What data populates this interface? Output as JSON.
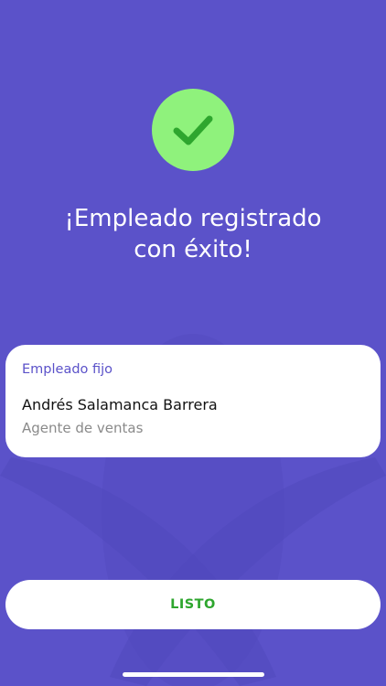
{
  "colors": {
    "background": "#5b52c9",
    "success_badge": "#8ff27c",
    "check_mark": "#2ea62e",
    "card_type_text": "#5b52c9",
    "button_text": "#2ea62e"
  },
  "success": {
    "icon": "check-icon",
    "title_line1": "¡Empleado registrado",
    "title_line2": "con éxito!"
  },
  "employee_card": {
    "type": "Empleado fijo",
    "name": "Andrés Salamanca Barrera",
    "role": "Agente de ventas"
  },
  "actions": {
    "done_label": "LISTO"
  }
}
